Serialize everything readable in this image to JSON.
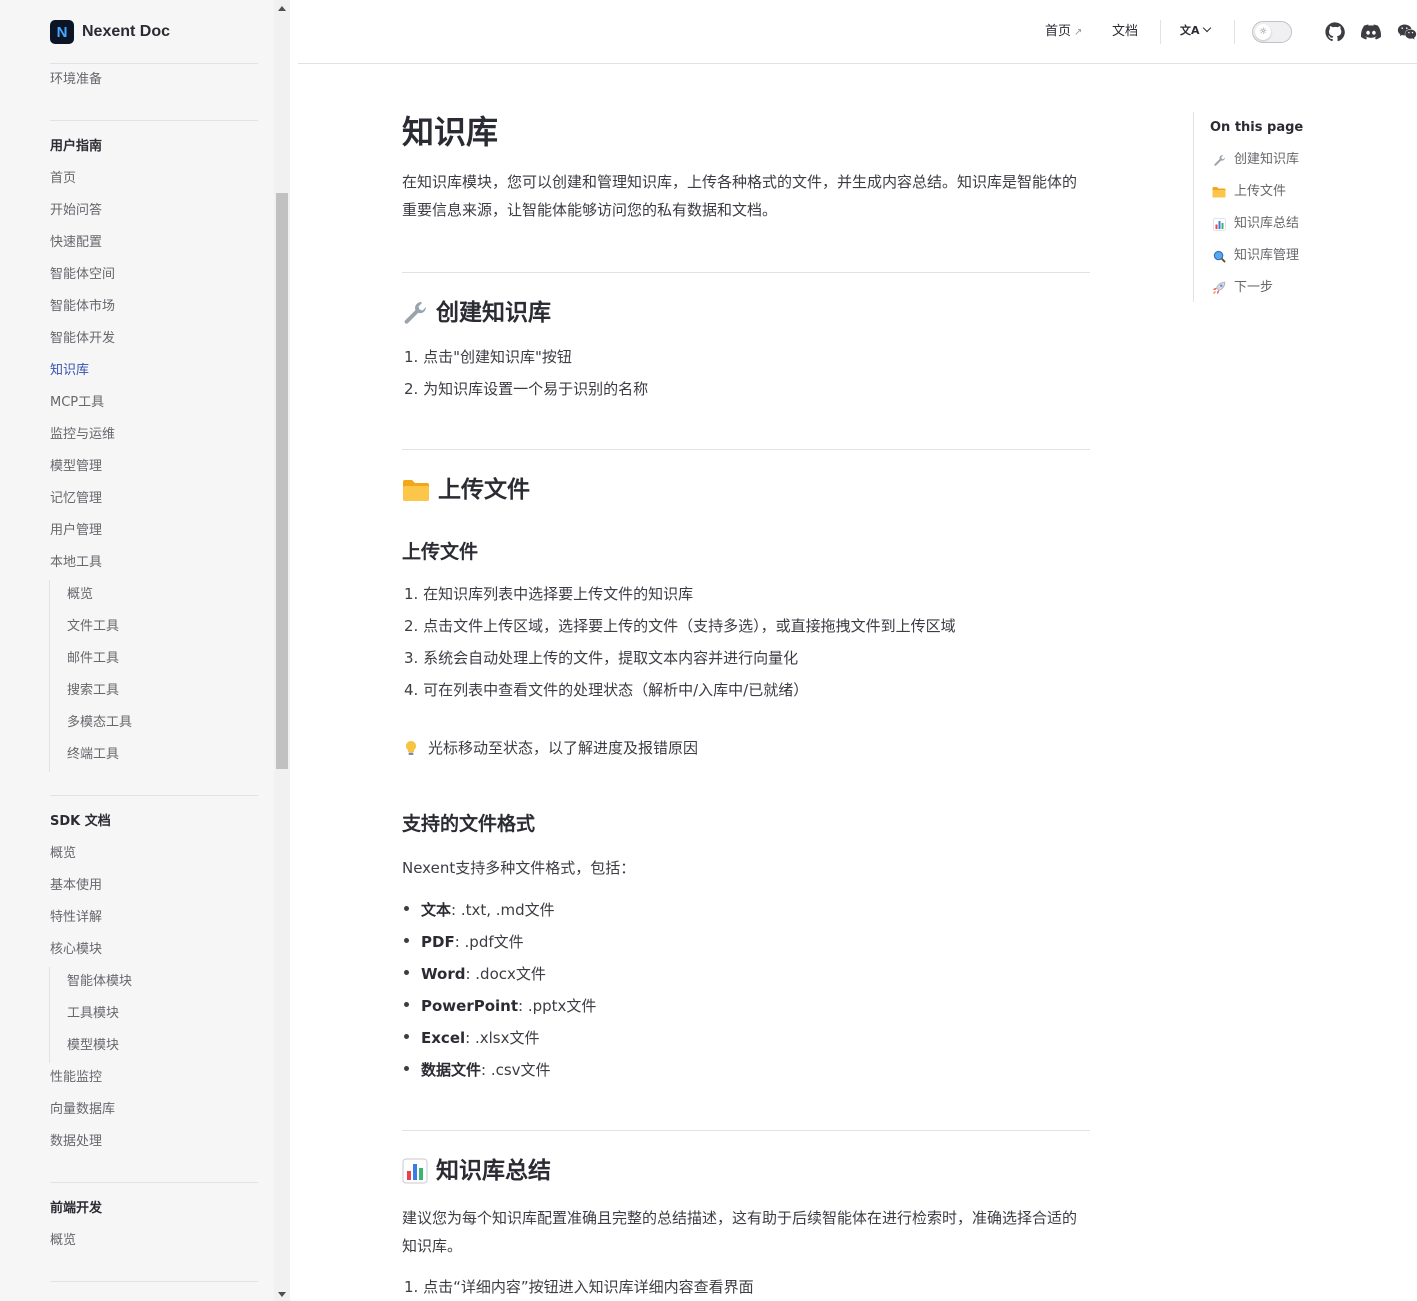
{
  "brand": {
    "name": "Nexent Doc",
    "logo_letter": "N"
  },
  "sidebar": {
    "top_item": "环境准备",
    "sections": [
      {
        "heading": "用户指南",
        "items": [
          "首页",
          "开始问答",
          "快速配置",
          "智能体空间",
          "智能体市场",
          "智能体开发",
          "知识库",
          "MCP工具",
          "监控与运维",
          "模型管理",
          "记忆管理",
          "用户管理",
          "本地工具"
        ],
        "sub_items": [
          "概览",
          "文件工具",
          "邮件工具",
          "搜索工具",
          "多模态工具",
          "终端工具"
        ]
      },
      {
        "heading": "SDK 文档",
        "items": [
          "概览",
          "基本使用",
          "特性详解",
          "核心模块"
        ],
        "sub_items": [
          "智能体模块",
          "工具模块",
          "模型模块"
        ],
        "items_after": [
          "性能监控",
          "向量数据库",
          "数据处理"
        ]
      },
      {
        "heading": "前端开发",
        "items": [
          "概览"
        ]
      }
    ],
    "active_item": "知识库"
  },
  "topnav": {
    "home": "首页",
    "home_ext": "↗",
    "docs": "文档",
    "lang_icon": "文A"
  },
  "content": {
    "title": "知识库",
    "intro": "在知识库模块，您可以创建和管理知识库，上传各种格式的文件，并生成内容总结。知识库是智能体的重要信息来源，让智能体能够访问您的私有数据和文档。",
    "create": {
      "heading": "创建知识库",
      "steps": [
        "1. 点击\"创建知识库\"按钮",
        "2. 为知识库设置一个易于识别的名称"
      ]
    },
    "upload": {
      "heading": "上传文件",
      "sub_heading": "上传文件",
      "steps": [
        "1. 在知识库列表中选择要上传文件的知识库",
        "2. 点击文件上传区域，选择要上传的文件（支持多选），或直接拖拽文件到上传区域",
        "3. 系统会自动处理上传的文件，提取文本内容并进行向量化",
        "4. 可在列表中查看文件的处理状态（解析中/入库中/已就绪）"
      ],
      "tip": "光标移动至状态，以了解进度及报错原因",
      "formats_heading": "支持的文件格式",
      "formats_intro": "Nexent支持多种文件格式，包括：",
      "formats": [
        {
          "label": "文本",
          "value": ": .txt, .md文件"
        },
        {
          "label": "PDF",
          "value": ": .pdf文件"
        },
        {
          "label": "Word",
          "value": ": .docx文件"
        },
        {
          "label": "PowerPoint",
          "value": ": .pptx文件"
        },
        {
          "label": "Excel",
          "value": ": .xlsx文件"
        },
        {
          "label": "数据文件",
          "value": ": .csv文件"
        }
      ]
    },
    "summary": {
      "heading": "知识库总结",
      "text": "建议您为每个知识库配置准确且完整的总结描述，这有助于后续智能体在进行检索时，准确选择合适的知识库。",
      "steps": [
        "1. 点击“详细内容”按钮进入知识库详细内容查看界面"
      ]
    }
  },
  "toc": {
    "title": "On this page",
    "items": [
      "创建知识库",
      "上传文件",
      "知识库总结",
      "知识库管理",
      "下一步"
    ]
  },
  "colors": {
    "accent": "#3451b2",
    "text": "#3c3c43",
    "sidebar_bg": "#f6f6f7"
  }
}
